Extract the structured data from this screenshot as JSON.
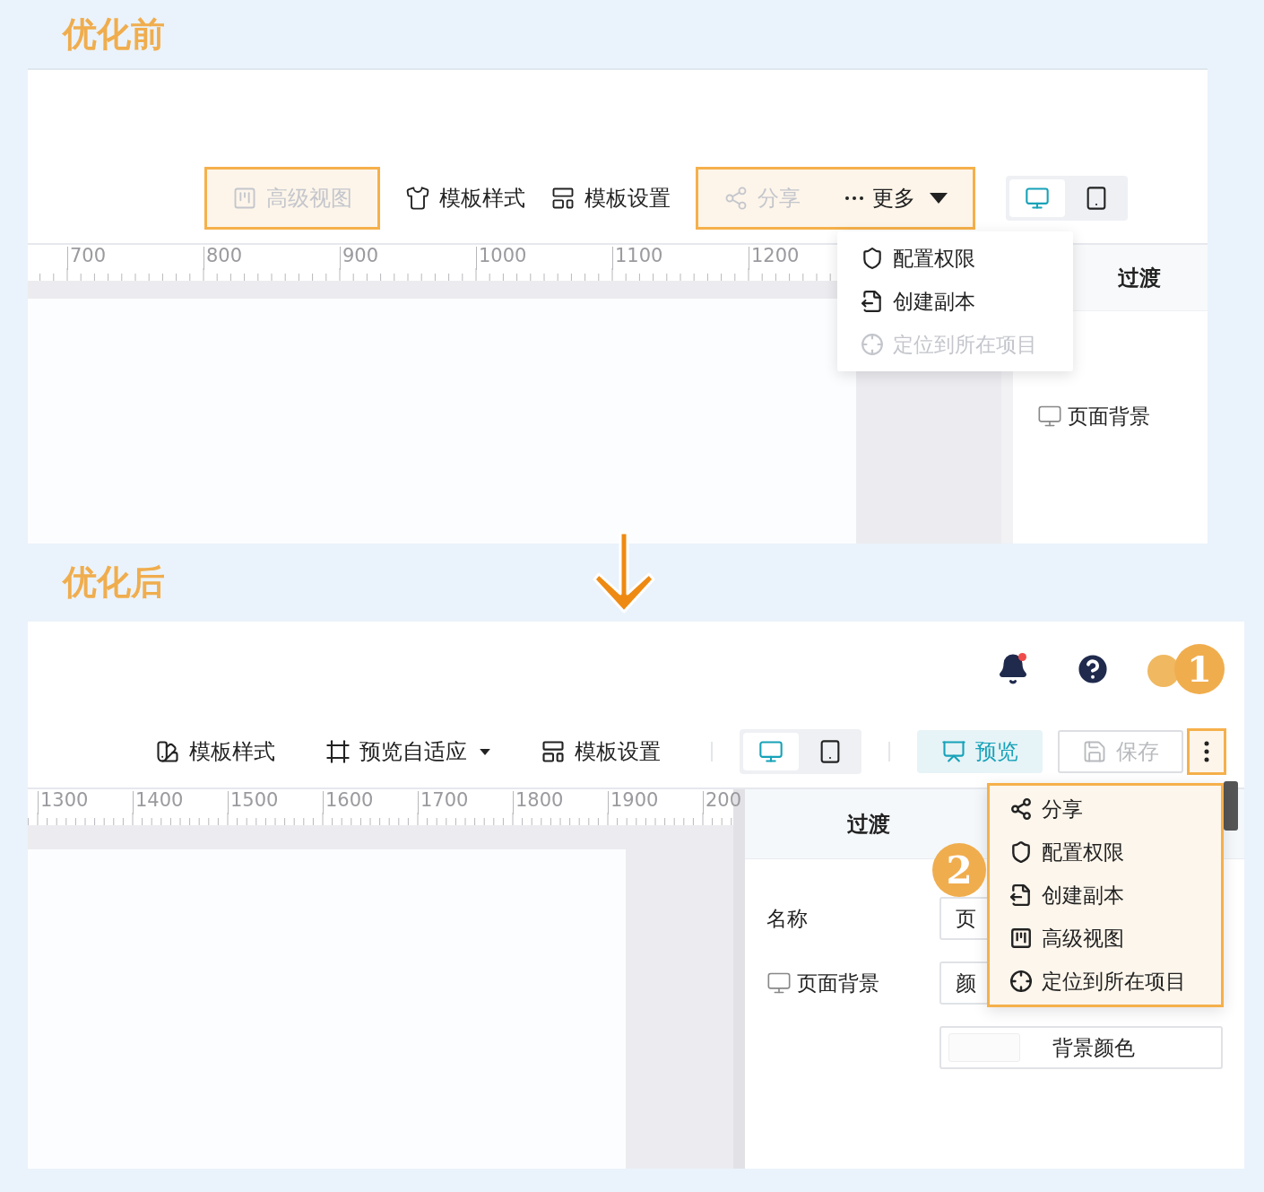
{
  "before": {
    "heading": "优化前",
    "toolbar": {
      "groups": [
        {
          "highlighted": true,
          "items": [
            {
              "label": "高级视图",
              "disabled": true,
              "dropdown": false
            }
          ]
        },
        {
          "highlighted": false,
          "items": [
            {
              "label": "模板样式",
              "disabled": false,
              "dropdown": false
            }
          ]
        },
        {
          "highlighted": false,
          "items": [
            {
              "label": "模板设置",
              "disabled": false,
              "dropdown": false
            }
          ]
        },
        {
          "highlighted": true,
          "items": [
            {
              "label": "分享",
              "disabled": true,
              "dropdown": false
            },
            {
              "label": "更多",
              "disabled": false,
              "dropdown": true
            }
          ]
        }
      ],
      "devices": [
        {
          "selected": true
        },
        {
          "selected": false
        }
      ]
    },
    "ruler": [
      "700",
      "800",
      "900",
      "1000",
      "1100",
      "1200"
    ],
    "menu": [
      {
        "label": "配置权限",
        "disabled": false
      },
      {
        "label": "创建副本",
        "disabled": false
      },
      {
        "label": "定位到所在项目",
        "disabled": true
      }
    ],
    "panel": {
      "title": "过渡",
      "rows": [
        "页面背景"
      ]
    }
  },
  "after": {
    "heading": "优化后",
    "notifications": {
      "unread": true
    },
    "badges": [
      "1",
      "2"
    ],
    "toolbar": {
      "items": [
        {
          "label": "模板样式",
          "dropdown": false
        },
        {
          "label": "预览自适应",
          "dropdown": true
        },
        {
          "label": "模板设置",
          "dropdown": false
        }
      ],
      "devices": [
        {
          "selected": true
        },
        {
          "selected": false
        }
      ],
      "preview": "预览",
      "save": {
        "label": "保存",
        "disabled": true
      },
      "more": {
        "highlighted": true
      }
    },
    "ruler": [
      "1300",
      "1400",
      "1500",
      "1600",
      "1700",
      "1800",
      "1900",
      "200"
    ],
    "menu": [
      {
        "label": "分享",
        "disabled": false
      },
      {
        "label": "配置权限",
        "disabled": false
      },
      {
        "label": "创建副本",
        "disabled": false
      },
      {
        "label": "高级视图",
        "disabled": false
      },
      {
        "label": "定位到所在项目",
        "disabled": false
      }
    ],
    "panel": {
      "title": "过渡",
      "fields": [
        {
          "label": "名称",
          "value": "页"
        },
        {
          "label": "页面背景",
          "value": "颜"
        }
      ],
      "color_button": "背景颜色"
    }
  }
}
